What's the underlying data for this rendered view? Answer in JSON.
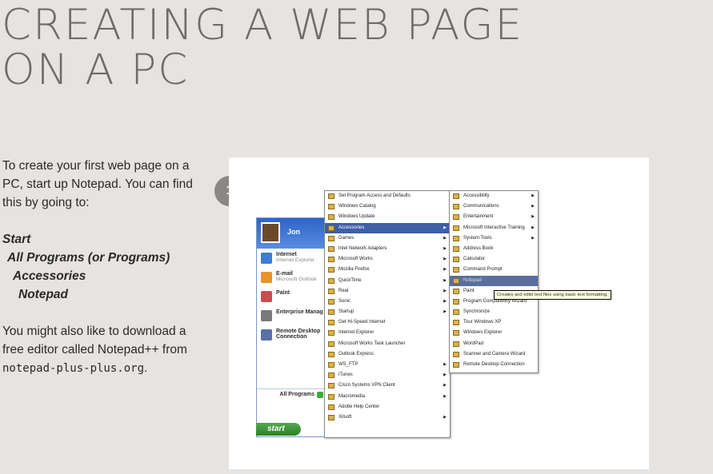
{
  "title": {
    "line1": "CREATING A WEB PAGE",
    "line2": "ON A PC"
  },
  "intro": "To create your first web page on a PC, start up Notepad. You can find this by going to:",
  "steps": [
    "Start",
    "All Programs (or Programs)",
    "Accessories",
    "Notepad"
  ],
  "outro_prefix": "You might also like to download a free editor called Notepad++ from ",
  "outro_code": "notepad-plus-plus.org",
  "outro_suffix": ".",
  "badge": "1",
  "screenshot": {
    "username": "Jon",
    "left_items": [
      {
        "title": "Internet",
        "sub": "Internet Explorer",
        "icon": "internet-explorer-icon",
        "color": "#3b7dd8"
      },
      {
        "title": "E-mail",
        "sub": "Microsoft Outlook",
        "icon": "outlook-icon",
        "color": "#e8942a"
      },
      {
        "title": "Paint",
        "sub": "",
        "icon": "paint-icon",
        "color": "#c94f4f"
      },
      {
        "title": "Enterprise Manag",
        "sub": "",
        "icon": "enterprise-manager-icon",
        "color": "#7a7a7a"
      },
      {
        "title": "Remote Desktop Connection",
        "sub": "",
        "icon": "remote-desktop-icon",
        "color": "#5a6fa8"
      }
    ],
    "all_programs": "All Programs",
    "start_label": "start",
    "programs_menu": [
      {
        "label": "Set Program Access and Defaults",
        "arrow": false
      },
      {
        "label": "Windows Catalog",
        "arrow": false
      },
      {
        "label": "Windows Update",
        "arrow": false
      },
      {
        "label": "Accessories",
        "arrow": true,
        "selected": true
      },
      {
        "label": "Games",
        "arrow": true
      },
      {
        "label": "Intel Network Adapters",
        "arrow": true
      },
      {
        "label": "Microsoft Works",
        "arrow": true
      },
      {
        "label": "Mozilla Firefox",
        "arrow": true
      },
      {
        "label": "QuickTime",
        "arrow": true
      },
      {
        "label": "Real",
        "arrow": true
      },
      {
        "label": "Sonic",
        "arrow": true
      },
      {
        "label": "Startup",
        "arrow": true
      },
      {
        "label": "Get Hi-Speed Internet",
        "arrow": false
      },
      {
        "label": "Internet Explorer",
        "arrow": false
      },
      {
        "label": "Microsoft Works Task Launcher",
        "arrow": false
      },
      {
        "label": "Outlook Express",
        "arrow": false
      },
      {
        "label": "WS_FTP",
        "arrow": true
      },
      {
        "label": "iTunes",
        "arrow": true
      },
      {
        "label": "Cisco Systems VPN Client",
        "arrow": true
      },
      {
        "label": "Macromedia",
        "arrow": true
      },
      {
        "label": "Adobe Help Center",
        "arrow": false
      },
      {
        "label": "Xilsoft",
        "arrow": true
      }
    ],
    "accessories_menu": [
      {
        "label": "Accessibility",
        "arrow": true
      },
      {
        "label": "Communications",
        "arrow": true
      },
      {
        "label": "Entertainment",
        "arrow": true
      },
      {
        "label": "Microsoft Interactive Training",
        "arrow": true
      },
      {
        "label": "System Tools",
        "arrow": true
      },
      {
        "label": "Address Book",
        "arrow": false
      },
      {
        "label": "Calculator",
        "arrow": false
      },
      {
        "label": "Command Prompt",
        "arrow": false
      },
      {
        "label": "Notepad",
        "arrow": false,
        "highlighted": true
      },
      {
        "label": "Paint",
        "arrow": false
      },
      {
        "label": "Program Compatibility Wizard",
        "arrow": false
      },
      {
        "label": "Synchronize",
        "arrow": false
      },
      {
        "label": "Tour Windows XP",
        "arrow": false
      },
      {
        "label": "Windows Explorer",
        "arrow": false
      },
      {
        "label": "WordPad",
        "arrow": false
      },
      {
        "label": "Scanner and Camera Wizard",
        "arrow": false
      },
      {
        "label": "Remote Desktop Connection",
        "arrow": false
      }
    ],
    "tooltip": "Creates and edits text files using basic text formatting."
  }
}
